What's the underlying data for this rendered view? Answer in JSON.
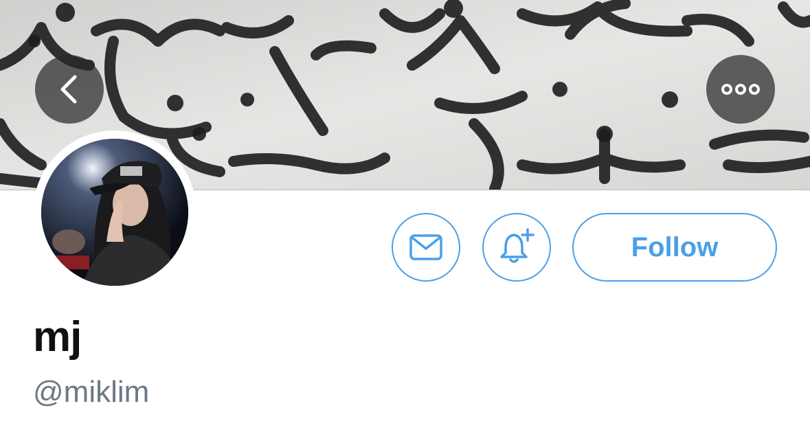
{
  "profile": {
    "display_name": "mj",
    "handle": "@miklim"
  },
  "actions": {
    "follow_label": "Follow"
  },
  "icons": {
    "back": "chevron-left-icon",
    "more": "more-horizontal-icon",
    "message": "envelope-icon",
    "notify": "bell-plus-icon"
  },
  "colors": {
    "accent": "#4a9fe8",
    "name": "#111111",
    "handle": "#6b7884"
  }
}
